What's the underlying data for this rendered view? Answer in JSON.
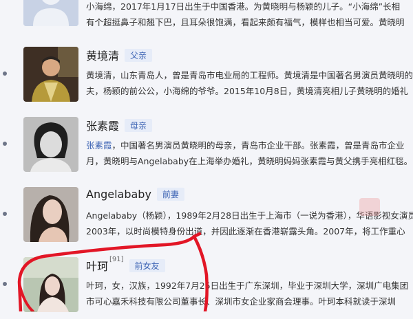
{
  "entries": [
    {
      "name": "",
      "relation": "",
      "desc_line1": "小海绵，2017年1月17日出生于中国香港。为黄晓明与杨颖的儿子。“小海绵”长相",
      "desc_line2": "有个超挺鼻子和翘下巴，且耳朵很饱满，看起来颇有福气，模样也相当可爱。黄晓明"
    },
    {
      "name": "黄境清",
      "relation": "父亲",
      "desc_line1": "黄境清，山东青岛人，曾是青岛市电业局的工程师。黄境清是中国著名男演员黄晓明的父亲，",
      "desc_line2": "夫，杨颖的前公公，小海绵的爷爷。2015年10月8日，黄境清亮相儿子黄晓明的婚礼"
    },
    {
      "name": "张素霞",
      "relation": "母亲",
      "desc_line1_link": "张素霞",
      "desc_line1_rest": "，中国著名男演员黄晓明的母亲，青岛市企业干部。张素霞，曾是青岛市企业",
      "desc_line2": "月，黄晓明与Angelababy在上海举办婚礼，黄晓明妈妈张素霞与黄父携手亮相红毯。"
    },
    {
      "name": "Angelababy",
      "relation": "前妻",
      "desc_line1": "Angelababy（杨颖），1989年2月28日出生于上海市（一说为香港），华语影视女演员、",
      "desc_line2": "2003年，以时尚模特身份出道，并因此逐渐在香港崭露头角。2007年，将工作重心"
    },
    {
      "name": "叶珂",
      "sup": "[91]",
      "relation": "前女友",
      "desc_line1": "叶珂，女，汉族，1992年7月25日出生于广东深圳，毕业于深圳大学，深圳广电集团",
      "desc_line2": "市可心嘉禾科技有限公司董事长、深圳市女企业家商会理事。叶珂本科就读于深圳"
    }
  ],
  "colors": {
    "accent": "#3d64b4",
    "tag_bg": "#e6ecf8",
    "annotation": "#e21626"
  }
}
